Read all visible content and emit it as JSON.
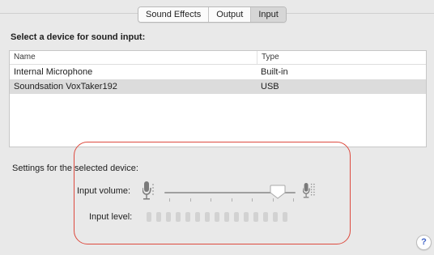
{
  "tabs": [
    {
      "label": "Sound Effects",
      "active": false
    },
    {
      "label": "Output",
      "active": false
    },
    {
      "label": "Input",
      "active": true
    }
  ],
  "device_heading": "Select a device for sound input:",
  "table": {
    "columns": [
      "Name",
      "Type"
    ],
    "rows": [
      {
        "name": "Internal Microphone",
        "type": "Built-in",
        "selected": false
      },
      {
        "name": "Soundsation VoxTaker192",
        "type": "USB",
        "selected": true
      }
    ]
  },
  "settings_label": "Settings for the selected device:",
  "input_volume": {
    "label": "Input volume:",
    "value_fraction": 0.85
  },
  "input_level": {
    "label": "Input level:",
    "segments": 15,
    "lit": 0
  },
  "help_button": "?",
  "colors": {
    "highlight_outline": "#dd4a3e",
    "selected_row": "#dcdcdc",
    "help_accent": "#3f63c7"
  }
}
